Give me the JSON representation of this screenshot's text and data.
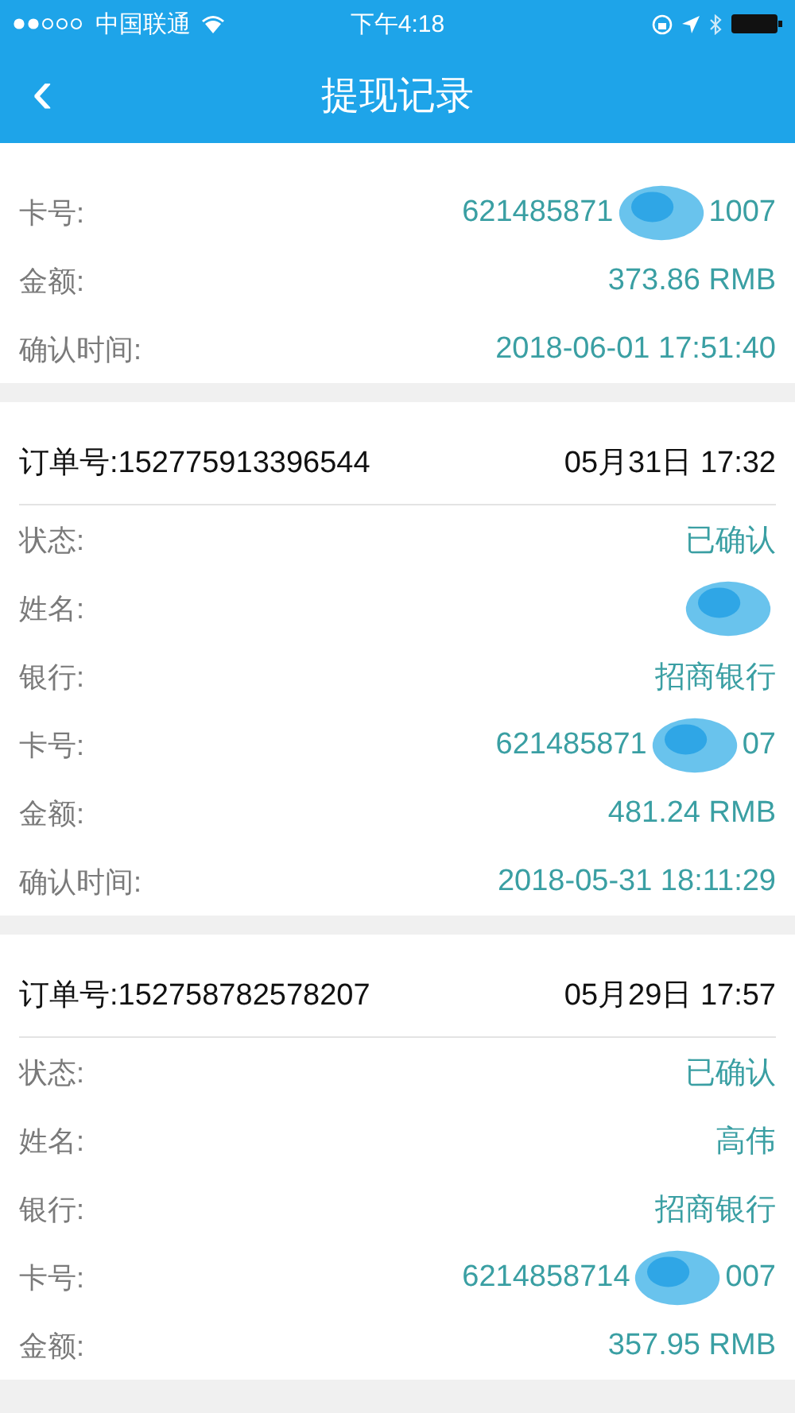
{
  "status_bar": {
    "carrier": "中国联通",
    "time": "下午4:18"
  },
  "nav": {
    "back": "‹",
    "title": "提现记录"
  },
  "records": [
    {
      "rows": [
        {
          "label": "卡号:",
          "value": "621485871",
          "tail": "1007",
          "redacted": true
        },
        {
          "label": "金额:",
          "value": "373.86 RMB",
          "redacted": false
        },
        {
          "label": "确认时间:",
          "value": "2018-06-01 17:51:40",
          "redacted": false
        }
      ]
    },
    {
      "header": {
        "order": "订单号:152775913396544",
        "date": "05月31日 17:32"
      },
      "rows": [
        {
          "label": "状态:",
          "value": "已确认",
          "redacted": false
        },
        {
          "label": "姓名:",
          "redacted": true
        },
        {
          "label": "银行:",
          "value": "招商银行",
          "redacted": false
        },
        {
          "label": "卡号:",
          "value": "621485871",
          "tail": "07",
          "redacted": true
        },
        {
          "label": "金额:",
          "value": "481.24 RMB",
          "redacted": false
        },
        {
          "label": "确认时间:",
          "value": "2018-05-31 18:11:29",
          "redacted": false
        }
      ]
    },
    {
      "header": {
        "order": "订单号:152758782578207",
        "date": "05月29日 17:57"
      },
      "rows": [
        {
          "label": "状态:",
          "value": "已确认",
          "redacted": false
        },
        {
          "label": "姓名:",
          "value": "高伟",
          "redacted": false
        },
        {
          "label": "银行:",
          "value": "招商银行",
          "redacted": false
        },
        {
          "label": "卡号:",
          "value": "6214858714",
          "tail": "007",
          "redacted": true
        },
        {
          "label": "金额:",
          "value": "357.95 RMB",
          "redacted": false
        }
      ]
    }
  ]
}
